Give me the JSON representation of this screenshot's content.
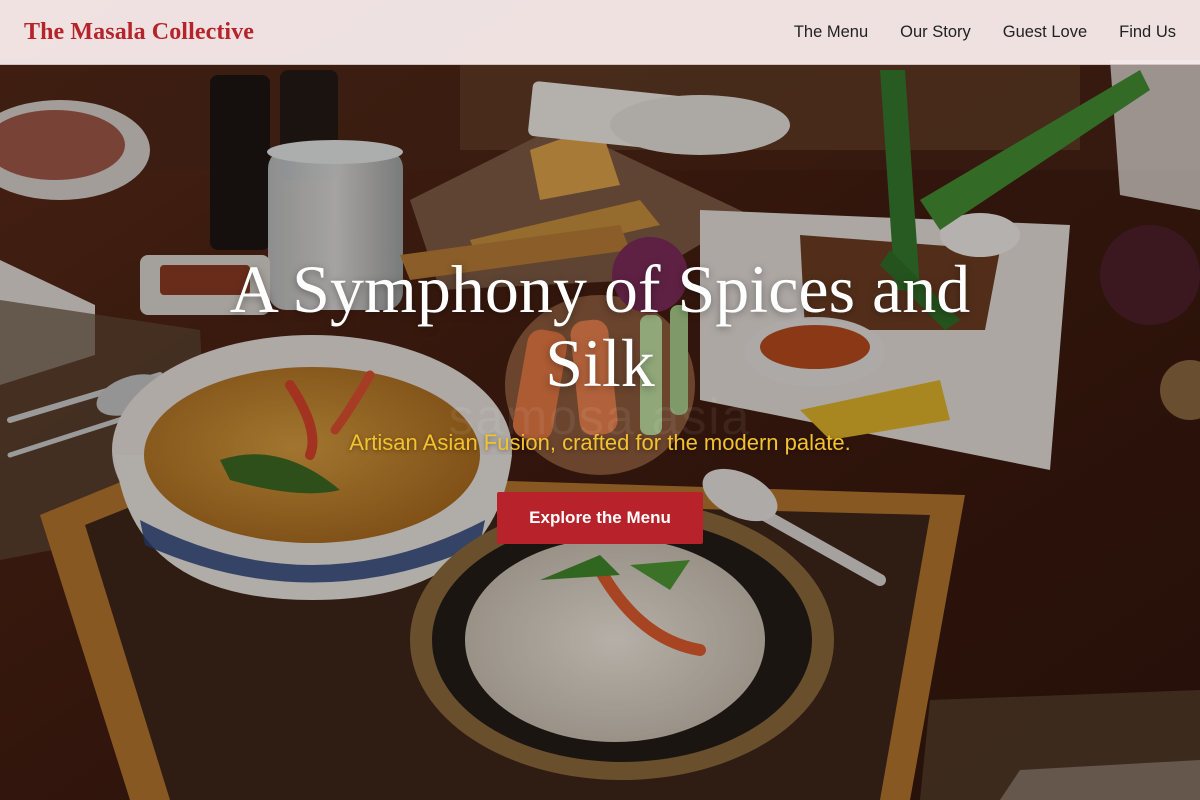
{
  "navbar": {
    "brand": "The Masala Collective",
    "links": [
      {
        "label": "The Menu"
      },
      {
        "label": "Our Story"
      },
      {
        "label": "Guest Love"
      },
      {
        "label": "Find Us"
      }
    ]
  },
  "hero": {
    "title": "A Symphony of Spices and Silk",
    "subtitle": "Artisan Asian Fusion, crafted for the modern palate.",
    "cta_label": "Explore the Menu",
    "watermark": "samosa asia"
  },
  "colors": {
    "brand": "#b5242b",
    "cta": "#b8222a",
    "subtitle": "#f2c230",
    "navbar_bg": "#faeeee"
  }
}
